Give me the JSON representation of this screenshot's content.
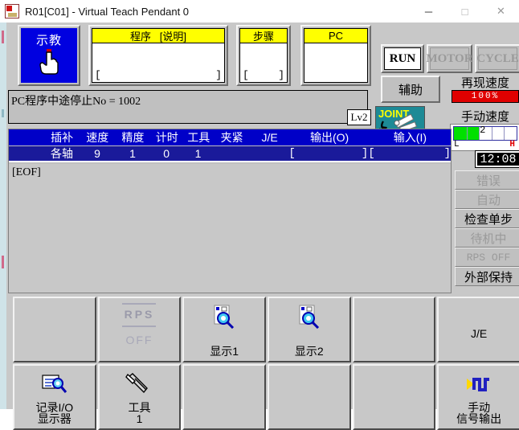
{
  "window": {
    "title": "R01[C01] - Virtual Teach Pendant 0",
    "app_icon": "robot-app-icon",
    "minimize": "─",
    "maximize": "□",
    "close": "✕"
  },
  "top": {
    "teach_button": {
      "label": "示教",
      "icon": "pointing-hand-icon"
    },
    "program_panel": {
      "header": "程序   [说明]",
      "bracket_open": "[",
      "bracket_close": "]",
      "value": ""
    },
    "step_panel": {
      "header": "步骤",
      "bracket_open": "[",
      "bracket_close": "]",
      "value": ""
    },
    "pc_panel": {
      "header": "PC",
      "value": ""
    },
    "mode_buttons": [
      {
        "label": "RUN",
        "state": "on"
      },
      {
        "label": "MOTOR",
        "state": "off"
      },
      {
        "label": "CYCLE",
        "state": "off"
      }
    ],
    "aux_button": "辅助"
  },
  "speed": {
    "replay_title": "再现速度",
    "replay_value": "100%",
    "replay_color": "#e00000",
    "manual_title": "手动速度",
    "manual_value": "2",
    "manual_fill_percent": 40,
    "manual_low": "L",
    "manual_high": "H",
    "manual_fill_color": "#00e000"
  },
  "message": {
    "text": "PC程序中途停止No = 1002",
    "level_badge": "Lv2"
  },
  "joint": {
    "label": "JOINT",
    "icon": "robot-arm-joint-icon"
  },
  "clock": "12:08",
  "table": {
    "columns": [
      "插补",
      "速度",
      "精度",
      "计时",
      "工具",
      "夹紧",
      "J/E",
      "输出(O)",
      "输入(I)"
    ],
    "row": {
      "interpolation": "各轴",
      "speed": "9",
      "precision": "1",
      "timer": "0",
      "tool": "1",
      "clamp": "",
      "je": "",
      "output_open": "[",
      "output_close": "]",
      "input_open": "[",
      "input_close": "]"
    }
  },
  "program_area": {
    "eof": "[EOF]"
  },
  "status_stack": [
    {
      "label": "错误",
      "state": "off"
    },
    {
      "label": "自动",
      "state": "off"
    },
    {
      "label": "检查单步",
      "state": "on"
    },
    {
      "label": "待机中",
      "state": "off"
    },
    {
      "label": "RPS OFF",
      "state": "off",
      "mono": true
    },
    {
      "label": "外部保持",
      "state": "on"
    }
  ],
  "function_grid": {
    "row1": [
      {
        "label": "",
        "icon": "",
        "state": "blank"
      },
      {
        "label": "OFF",
        "icon": "rps-off-icon",
        "state": "disabled",
        "top_text": "RPS"
      },
      {
        "label": "显示1",
        "icon": "document-search-icon",
        "state": "on"
      },
      {
        "label": "显示2",
        "icon": "document-search-icon",
        "state": "on"
      },
      {
        "label": "",
        "icon": "",
        "state": "blank"
      },
      {
        "label": "J/E",
        "icon": "",
        "state": "on"
      }
    ],
    "row2": [
      {
        "label_line1": "记录I/O",
        "label_line2": "显示器",
        "icon": "list-search-icon",
        "state": "on"
      },
      {
        "label_line1": "工具",
        "label_line2": "1",
        "icon": "tool-wrench-icon",
        "state": "on"
      },
      {
        "label_line1": "",
        "label_line2": "",
        "icon": "",
        "state": "blank"
      },
      {
        "label_line1": "",
        "label_line2": "",
        "icon": "",
        "state": "blank"
      },
      {
        "label_line1": "",
        "label_line2": "",
        "icon": "",
        "state": "blank"
      },
      {
        "label_line1": "手动",
        "label_line2": "信号输出",
        "icon": "signal-pulse-icon",
        "state": "on"
      }
    ]
  }
}
